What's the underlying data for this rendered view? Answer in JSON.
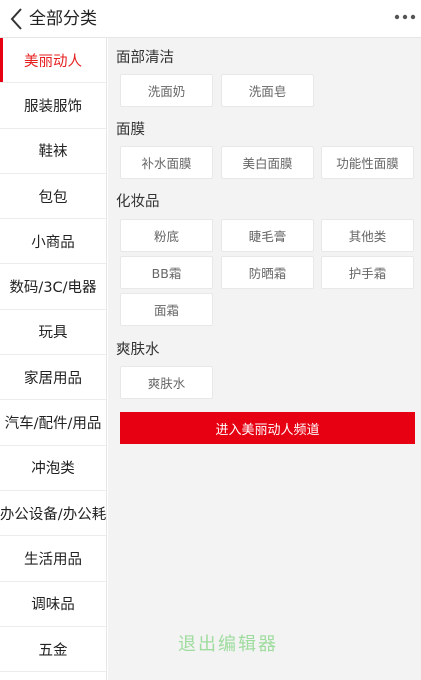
{
  "header": {
    "title": "全部分类",
    "back_icon": "chevron-left-icon",
    "more_icon": "more-dots-icon"
  },
  "sidebar": {
    "items": [
      {
        "label": "美丽动人",
        "active": true
      },
      {
        "label": "服装服饰"
      },
      {
        "label": "鞋袜"
      },
      {
        "label": "包包"
      },
      {
        "label": "小商品"
      },
      {
        "label": "数码/3C/电器"
      },
      {
        "label": "玩具"
      },
      {
        "label": "家居用品"
      },
      {
        "label": "汽车/配件/用品"
      },
      {
        "label": "冲泡类"
      },
      {
        "label": "办公设备/办公耗"
      },
      {
        "label": "生活用品"
      },
      {
        "label": "调味品"
      },
      {
        "label": "五金"
      }
    ]
  },
  "main": {
    "sections": [
      {
        "title": "面部清洁",
        "tags": [
          "洗面奶",
          "洗面皂"
        ]
      },
      {
        "title": "面膜",
        "tags": [
          "补水面膜",
          "美白面膜",
          "功能性面膜"
        ]
      },
      {
        "title": "化妆品",
        "tags": [
          "粉底",
          "睫毛膏",
          "其他类",
          "BB霜",
          "防晒霜",
          "护手霜",
          "面霜"
        ]
      },
      {
        "title": "爽肤水",
        "tags": [
          "爽肤水"
        ]
      }
    ],
    "enter_button": "进入美丽动人频道",
    "bottom_hint": "退出编辑器"
  },
  "colors": {
    "accent": "#e60012",
    "active_text": "#e61e1e",
    "panel_bg": "#f3f3f3"
  }
}
